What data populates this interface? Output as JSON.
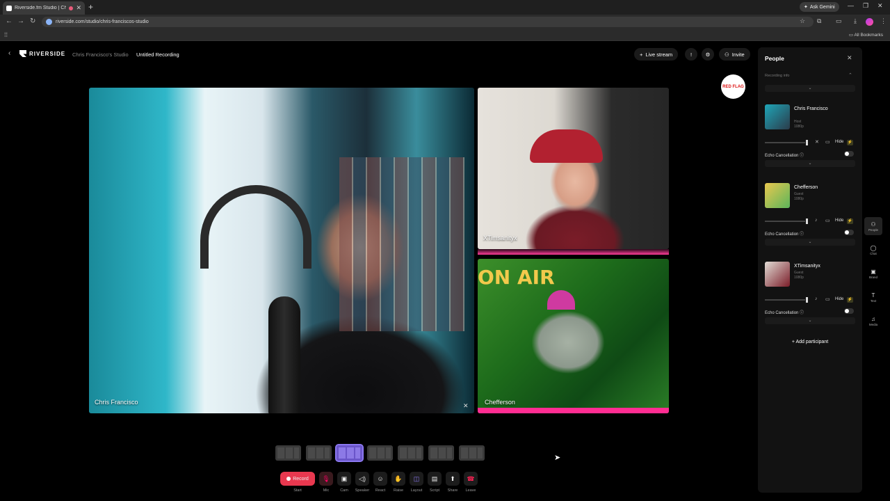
{
  "browser": {
    "tab_title": "Riverside.fm Studio | Chris",
    "url": "riverside.com/studio/chris-franciscos-studio",
    "ask_gemini": "Ask Gemini",
    "all_bookmarks": "All Bookmarks"
  },
  "header": {
    "brand": "RIVERSIDE",
    "studio": "Chris Francisco's Studio",
    "recording": "Untitled Recording",
    "live_stream": "Live stream",
    "invite": "Invite"
  },
  "stage": {
    "main_name": "Chris Francisco",
    "top_right_name": "XTimsanityx",
    "bottom_right_name": "Chefferson",
    "bottom_right_banner": "ON AIR",
    "logo_text": "RED FLAG"
  },
  "controls": [
    {
      "key": "start",
      "label": "Start",
      "button": "Record",
      "icon": "record-dot"
    },
    {
      "key": "mic",
      "label": "Mic",
      "icon": "mic-off-icon"
    },
    {
      "key": "cam",
      "label": "Cam",
      "icon": "camera-icon"
    },
    {
      "key": "speaker",
      "label": "Speaker",
      "icon": "speaker-icon"
    },
    {
      "key": "react",
      "label": "React",
      "icon": "smiley-icon"
    },
    {
      "key": "raise",
      "label": "Raise",
      "icon": "hand-icon"
    },
    {
      "key": "layout",
      "label": "Layout",
      "icon": "layout-icon"
    },
    {
      "key": "script",
      "label": "Script",
      "icon": "script-icon"
    },
    {
      "key": "share",
      "label": "Share",
      "icon": "share-icon"
    },
    {
      "key": "leave",
      "label": "Leave",
      "icon": "phone-hangup-icon"
    }
  ],
  "panel": {
    "title": "People",
    "recording_info": "Recording info",
    "people": [
      {
        "name": "Chris Francisco",
        "role": "Host",
        "quality": "1080p"
      },
      {
        "name": "Chefferson",
        "role": "Guest",
        "quality": "1080p"
      },
      {
        "name": "XTimsanityx",
        "role": "Guest",
        "quality": "1080p"
      }
    ],
    "hide_label": "Hide",
    "echo_label": "Echo Cancellation",
    "add_participant": "Add participant"
  },
  "rail": [
    {
      "label": "People",
      "icon": "people-icon"
    },
    {
      "label": "Chat",
      "icon": "chat-icon"
    },
    {
      "label": "Brand",
      "icon": "brand-icon"
    },
    {
      "label": "Text",
      "icon": "text-icon"
    },
    {
      "label": "Media",
      "icon": "music-note-icon"
    }
  ],
  "colors": {
    "record": "#e8384f",
    "accent": "#6a55c9",
    "on_air_pink": "#ff2d92"
  }
}
